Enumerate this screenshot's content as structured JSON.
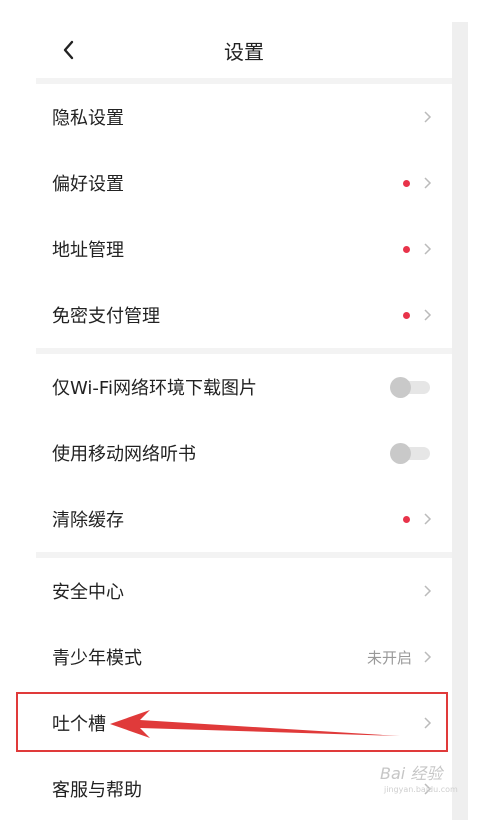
{
  "header": {
    "title": "设置"
  },
  "sections": [
    {
      "rows": [
        {
          "label": "隐私设置",
          "dot": false
        },
        {
          "label": "偏好设置",
          "dot": true
        },
        {
          "label": "地址管理",
          "dot": true
        },
        {
          "label": "免密支付管理",
          "dot": true
        }
      ]
    },
    {
      "rows": [
        {
          "label": "仅Wi-Fi网络环境下载图片",
          "toggle": "off"
        },
        {
          "label": "使用移动网络听书",
          "toggle": "off"
        },
        {
          "label": "清除缓存",
          "dot": true
        }
      ]
    },
    {
      "rows": [
        {
          "label": "安全中心"
        },
        {
          "label": "青少年模式",
          "value": "未开启"
        },
        {
          "label": "吐个槽",
          "highlighted": true
        },
        {
          "label": "客服与帮助"
        }
      ]
    }
  ],
  "colors": {
    "dot": "#e8334a",
    "highlight": "#e03a3a",
    "arrow": "#e03a3a",
    "divider": "#f3f3f3"
  },
  "icons": {
    "back": "chevron-left-icon",
    "row_arrow": "chevron-right-icon"
  },
  "watermark": {
    "main": "Bai 经验",
    "sub": "jingyan.baidu.com"
  }
}
